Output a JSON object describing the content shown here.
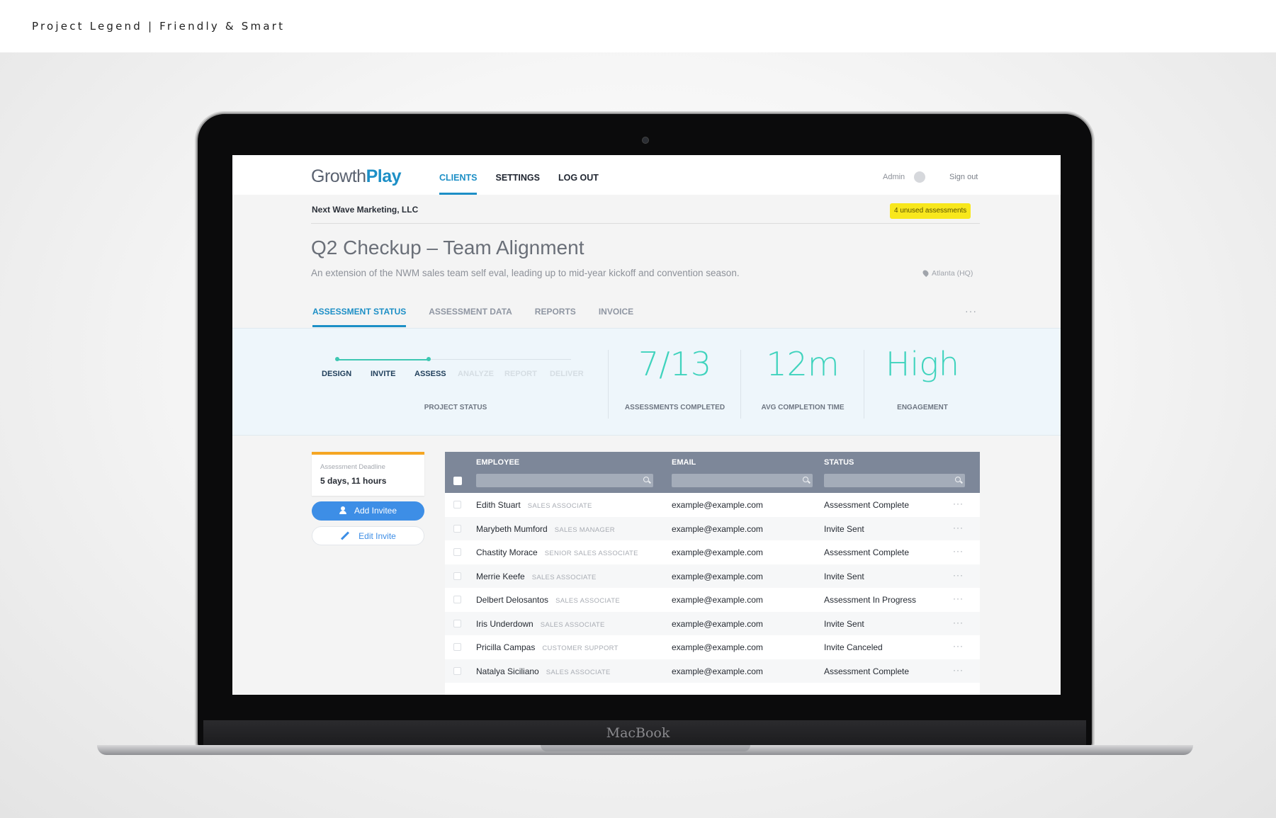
{
  "caption": "Project Legend | Friendly & Smart",
  "device_label": "MacBook",
  "app": {
    "logo_part1": "Growth",
    "logo_part2": "Play",
    "nav": [
      "CLIENTS",
      "SETTINGS",
      "LOG OUT"
    ],
    "admin_label": "Admin",
    "signout_label": "Sign out"
  },
  "project": {
    "company": "Next Wave Marketing, LLC",
    "badge": "4 unused assessments",
    "title": "Q2 Checkup – Team Alignment",
    "description": "An extension of the NWM sales team self eval, leading up to mid-year kickoff and convention season.",
    "location": "Atlanta (HQ)"
  },
  "tabs": [
    "ASSESSMENT STATUS",
    "ASSESSMENT DATA",
    "REPORTS",
    "INVOICE"
  ],
  "tab_more": "···",
  "status": {
    "steps_done": [
      "DESIGN",
      "INVITE",
      "ASSESS"
    ],
    "steps_pending": [
      "ANALYZE",
      "REPORT",
      "DELIVER"
    ],
    "project_status_label": "PROJECT STATUS",
    "completed_value": "7/13",
    "completed_label": "ASSESSMENTS COMPLETED",
    "avg_time_value": "12m",
    "avg_time_label": "AVG COMPLETION TIME",
    "engagement_value": "High",
    "engagement_label": "ENGAGEMENT"
  },
  "sidebar": {
    "deadline_label": "Assessment Deadline",
    "deadline_value": "5 days, 11 hours",
    "add_button": "Add Invitee",
    "edit_button": "Edit Invite"
  },
  "table": {
    "columns": [
      "EMPLOYEE",
      "EMAIL",
      "STATUS"
    ],
    "rows": [
      {
        "name": "Edith Stuart",
        "role": "SALES ASSOCIATE",
        "email": "example@example.com",
        "status": "Assessment Complete"
      },
      {
        "name": "Marybeth Mumford",
        "role": "SALES MANAGER",
        "email": "example@example.com",
        "status": "Invite Sent"
      },
      {
        "name": "Chastity Morace",
        "role": "SENIOR SALES ASSOCIATE",
        "email": "example@example.com",
        "status": "Assessment Complete"
      },
      {
        "name": "Merrie Keefe",
        "role": "SALES ASSOCIATE",
        "email": "example@example.com",
        "status": "Invite Sent"
      },
      {
        "name": "Delbert Delosantos",
        "role": "SALES ASSOCIATE",
        "email": "example@example.com",
        "status": "Assessment In Progress"
      },
      {
        "name": "Iris Underdown",
        "role": "SALES ASSOCIATE",
        "email": "example@example.com",
        "status": "Invite Sent"
      },
      {
        "name": "Pricilla Campas",
        "role": "CUSTOMER SUPPORT",
        "email": "example@example.com",
        "status": "Invite Canceled"
      },
      {
        "name": "Natalya Siciliano",
        "role": "SALES ASSOCIATE",
        "email": "example@example.com",
        "status": "Assessment Complete"
      }
    ],
    "row_more": "···"
  },
  "colors": {
    "accent": "#1d8fc6",
    "teal": "#3fd3bd",
    "badge": "#f8e71c",
    "deadline_bar": "#f5a623",
    "button": "#3d8ee6"
  },
  "icons": [
    "location-pin-icon",
    "add-user-icon",
    "pencil-icon",
    "search-icon",
    "more-icon"
  ]
}
